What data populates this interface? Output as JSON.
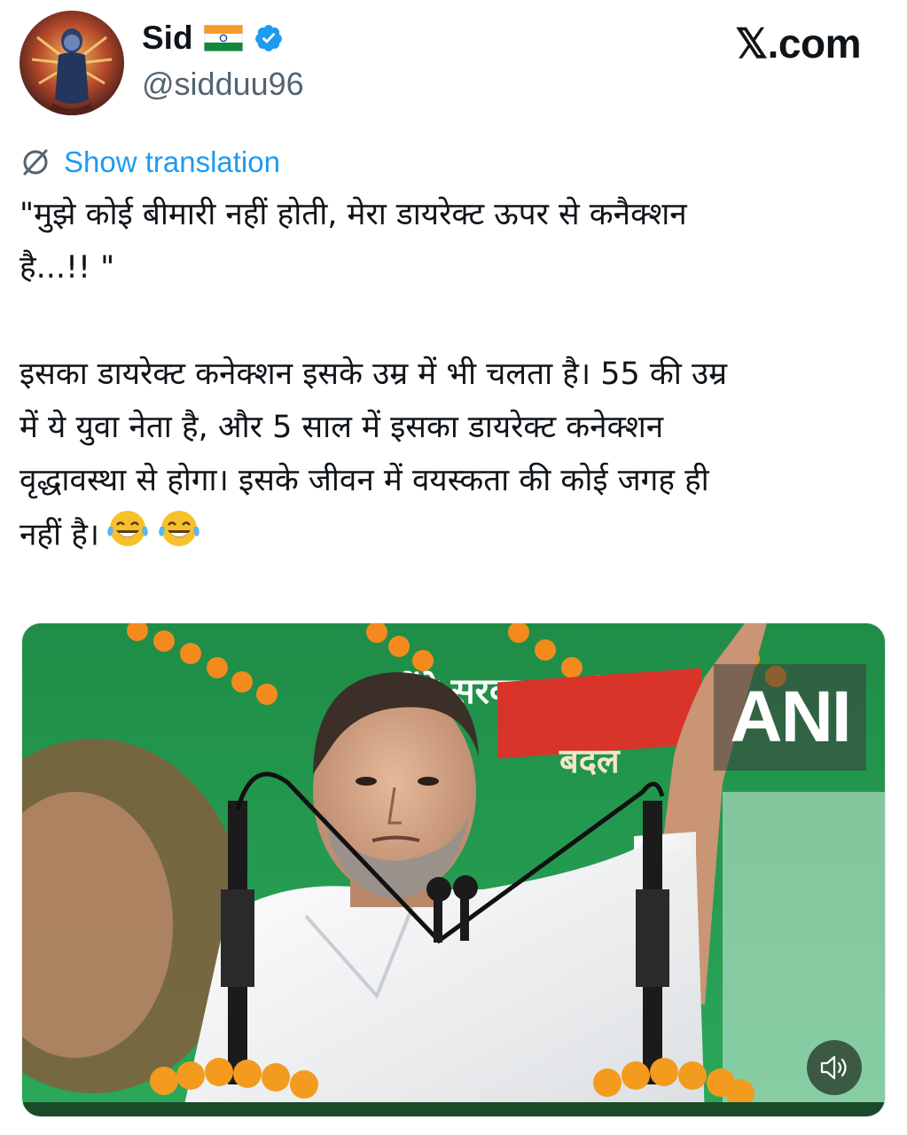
{
  "author": {
    "name": "Sid",
    "flag": "🇮🇳",
    "handle": "@sidduu96",
    "verified": true,
    "avatar_icon": "deity-avatar"
  },
  "brand": "𝕏.com",
  "translate": {
    "label": "Show translation",
    "icon": "translate-icon"
  },
  "tweet": {
    "quote": "\"मुझे कोई बीमारी नहीं होती, मेरा डायरेक्ट ऊपर से कनैक्शन\nहै...!! \"",
    "body": "इसका डायरेक्ट कनेक्शन इसके उम्र में भी चलता है। 55 की उम्र\nमें ये युवा नेता है, और 5 साल में इसका डायरेक्ट कनेक्शन\nवृद्धावस्था से होगा। इसके जीवन में वयस्कता की कोई जगह ही\nनहीं है।",
    "emojis": [
      "face-with-tears-of-joy",
      "face-with-tears-of-joy"
    ]
  },
  "media": {
    "watermark": "ANI",
    "banner_text_top": "लेंगे सरकार",
    "banner_text_red": "बदल",
    "mute_icon": "speaker-icon"
  },
  "colors": {
    "link": "#1d9bf0",
    "verified": "#1d9bf0",
    "handle": "#536471",
    "banner_green": "#1f9a4a",
    "banner_red": "#d8342a"
  }
}
